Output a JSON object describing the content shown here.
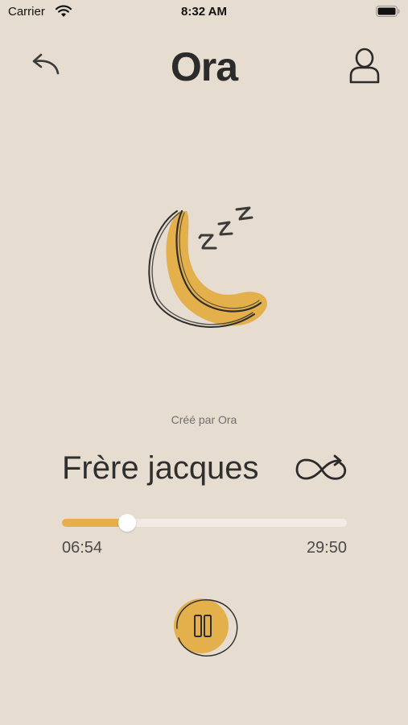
{
  "status_bar": {
    "carrier": "Carrier",
    "time": "8:32 AM"
  },
  "header": {
    "title": "Ora",
    "back_icon": "back-arrow-icon",
    "profile_icon": "user-icon"
  },
  "player": {
    "creator": "Créé par Ora",
    "track_title": "Frère jacques",
    "elapsed": "06:54",
    "total": "29:50",
    "progress": 0.23,
    "loop_icon": "infinity-loop-icon",
    "play_state_icon": "pause-icon"
  },
  "colors": {
    "background": "#e6dccf",
    "accent": "#e3b04b",
    "ink": "#2b2b2b"
  }
}
